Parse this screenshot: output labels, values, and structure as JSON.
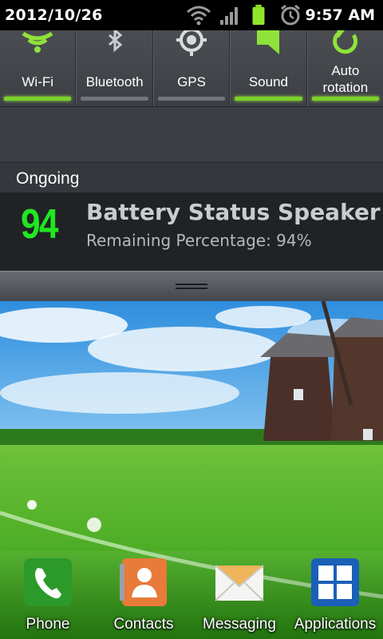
{
  "status_bar": {
    "date": "2012/10/26",
    "time": "9:57 AM"
  },
  "toggles": [
    {
      "label": "Wi-Fi",
      "state": "on",
      "icon": "wifi-icon"
    },
    {
      "label": "Bluetooth",
      "state": "off",
      "icon": "bluetooth-icon"
    },
    {
      "label": "GPS",
      "state": "off",
      "icon": "gps-icon"
    },
    {
      "label": "Sound",
      "state": "on",
      "icon": "sound-icon"
    },
    {
      "label": "Auto\nrotation",
      "state": "on",
      "icon": "rotation-icon"
    }
  ],
  "ongoing": {
    "header": "Ongoing",
    "notification": {
      "number": "94",
      "title": "Battery Status Speaker",
      "subtitle": "Remaining Percentage: 94%"
    }
  },
  "dock": [
    {
      "label": "Phone",
      "icon": "phone-icon"
    },
    {
      "label": "Contacts",
      "icon": "contacts-icon"
    },
    {
      "label": "Messaging",
      "icon": "messaging-icon"
    },
    {
      "label": "Applications",
      "icon": "applications-icon"
    }
  ],
  "colors": {
    "accent_green": "#7cd22a",
    "number_green": "#22e622"
  }
}
